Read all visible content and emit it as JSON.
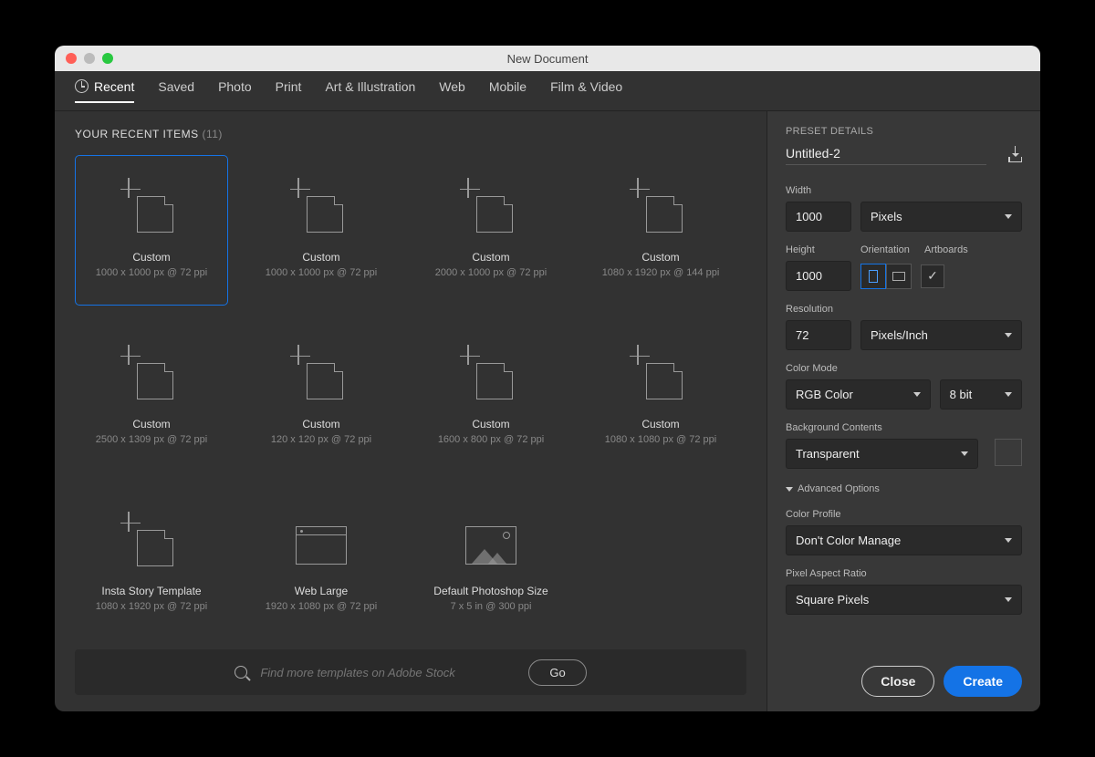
{
  "window": {
    "title": "New Document"
  },
  "tabs": {
    "items": [
      "Recent",
      "Saved",
      "Photo",
      "Print",
      "Art & Illustration",
      "Web",
      "Mobile",
      "Film & Video"
    ],
    "active_index": 0
  },
  "recent": {
    "header": "YOUR RECENT ITEMS",
    "count": "(11)",
    "items": [
      {
        "title": "Custom",
        "sub": "1000 x 1000 px @ 72 ppi",
        "icon": "doc",
        "selected": true
      },
      {
        "title": "Custom",
        "sub": "1000 x 1000 px @ 72 ppi",
        "icon": "doc"
      },
      {
        "title": "Custom",
        "sub": "2000 x 1000 px @ 72 ppi",
        "icon": "doc"
      },
      {
        "title": "Custom",
        "sub": "1080 x 1920 px @ 144 ppi",
        "icon": "doc"
      },
      {
        "title": "Custom",
        "sub": "2500 x 1309 px @ 72 ppi",
        "icon": "doc"
      },
      {
        "title": "Custom",
        "sub": "120 x 120 px @ 72 ppi",
        "icon": "doc"
      },
      {
        "title": "Custom",
        "sub": "1600 x 800 px @ 72 ppi",
        "icon": "doc"
      },
      {
        "title": "Custom",
        "sub": "1080 x 1080 px @ 72 ppi",
        "icon": "doc"
      },
      {
        "title": "Insta Story Template",
        "sub": "1080 x 1920 px @ 72 ppi",
        "icon": "doc"
      },
      {
        "title": "Web Large",
        "sub": "1920 x 1080 px @ 72 ppi",
        "icon": "browser"
      },
      {
        "title": "Default Photoshop Size",
        "sub": "7 x 5 in @ 300 ppi",
        "icon": "image"
      }
    ]
  },
  "stock": {
    "placeholder": "Find more templates on Adobe Stock",
    "go": "Go"
  },
  "details": {
    "header": "PRESET DETAILS",
    "name": "Untitled-2",
    "width_label": "Width",
    "width": "1000",
    "width_unit": "Pixels",
    "height_label": "Height",
    "height": "1000",
    "orientation_label": "Orientation",
    "orientation": "portrait",
    "artboards_label": "Artboards",
    "artboards_checked": true,
    "resolution_label": "Resolution",
    "resolution": "72",
    "resolution_unit": "Pixels/Inch",
    "color_mode_label": "Color Mode",
    "color_mode": "RGB Color",
    "bit_depth": "8 bit",
    "bg_label": "Background Contents",
    "bg": "Transparent",
    "advanced_label": "Advanced Options",
    "profile_label": "Color Profile",
    "profile": "Don't Color Manage",
    "par_label": "Pixel Aspect Ratio",
    "par": "Square Pixels"
  },
  "footer": {
    "close": "Close",
    "create": "Create"
  }
}
